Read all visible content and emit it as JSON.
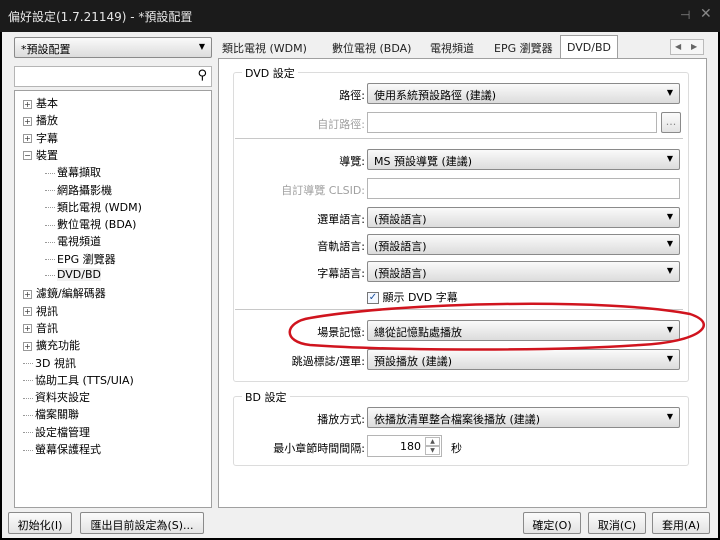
{
  "window": {
    "title": "偏好設定(1.7.21149) - *預設配置",
    "pin_icon": "pin-icon",
    "close_icon": "close-icon"
  },
  "profile": {
    "selected": "*預設配置"
  },
  "search": {
    "value": "",
    "icon": "search-icon"
  },
  "tree": [
    {
      "label": "基本",
      "level": 0,
      "expander": "+"
    },
    {
      "label": "播放",
      "level": 0,
      "expander": "+"
    },
    {
      "label": "字幕",
      "level": 0,
      "expander": "+"
    },
    {
      "label": "裝置",
      "level": 0,
      "expander": "-"
    },
    {
      "label": "螢幕擷取",
      "level": 1
    },
    {
      "label": "網路攝影機",
      "level": 1
    },
    {
      "label": "類比電視 (WDM)",
      "level": 1
    },
    {
      "label": "數位電視 (BDA)",
      "level": 1
    },
    {
      "label": "電視頻道",
      "level": 1
    },
    {
      "label": "EPG 瀏覽器",
      "level": 1
    },
    {
      "label": "DVD/BD",
      "level": 1,
      "selected": true
    },
    {
      "label": "濾鏡/編解碼器",
      "level": 0,
      "expander": "+"
    },
    {
      "label": "視訊",
      "level": 0,
      "expander": "+"
    },
    {
      "label": "音訊",
      "level": 0,
      "expander": "+"
    },
    {
      "label": "擴充功能",
      "level": 0,
      "expander": "+"
    },
    {
      "label": "3D 視訊",
      "level": 0
    },
    {
      "label": "協助工具 (TTS/UIA)",
      "level": 0
    },
    {
      "label": "資料夾設定",
      "level": 0
    },
    {
      "label": "檔案關聯",
      "level": 0
    },
    {
      "label": "設定檔管理",
      "level": 0
    },
    {
      "label": "螢幕保護程式",
      "level": 0
    }
  ],
  "tabs": [
    "類比電視 (WDM)",
    "數位電視 (BDA)",
    "電視頻道",
    "EPG 瀏覽器",
    "DVD/BD"
  ],
  "active_tab": "DVD/BD",
  "dvd": {
    "title": "DVD 設定",
    "path_label": "路徑:",
    "path_value": "使用系統預設路徑 (建議)",
    "custom_path_label": "自訂路徑:",
    "custom_path_value": "",
    "browse_label": "...",
    "navigator_label": "導覽:",
    "navigator_value": "MS 預設導覽 (建議)",
    "custom_nav_label": "自訂導覽 CLSID:",
    "custom_nav_value": "",
    "menu_lang_label": "選單語言:",
    "menu_lang_value": "(預設語言)",
    "audio_lang_label": "音軌語言:",
    "audio_lang_value": "(預設語言)",
    "sub_lang_label": "字幕語言:",
    "sub_lang_value": "(預設語言)",
    "show_subs_label": "顯示 DVD 字幕",
    "show_subs_checked": true,
    "resume_label": "場景記憶:",
    "resume_value": "總從記憶點處播放",
    "skip_label": "跳過標誌/選單:",
    "skip_value": "預設播放 (建議)"
  },
  "bd": {
    "title": "BD 設定",
    "mode_label": "播放方式:",
    "mode_value": "依播放清單整合檔案後播放 (建議)",
    "min_chapter_label": "最小章節時間間隔:",
    "min_chapter_value": "180",
    "unit": "秒"
  },
  "buttons": {
    "reset": "初始化(I)",
    "export": "匯出目前設定為(S)...",
    "ok": "確定(O)",
    "cancel": "取消(C)",
    "apply": "套用(A)"
  },
  "annotation_color": "#d0141e"
}
